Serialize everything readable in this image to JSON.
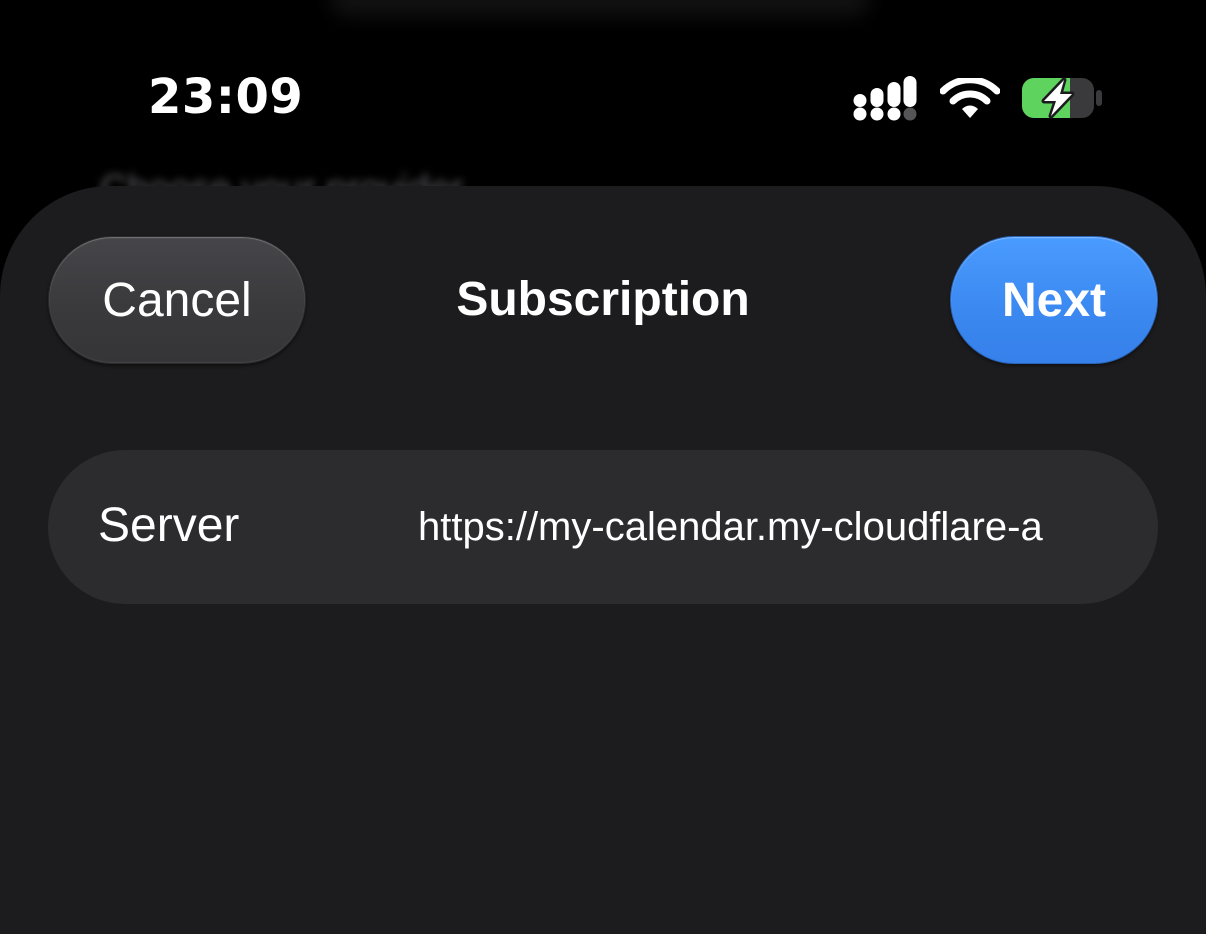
{
  "status_bar": {
    "time": "23:09",
    "icons": [
      "cellular-signal-icon",
      "wifi-icon",
      "battery-charging-icon"
    ]
  },
  "background": {
    "title": "Choose your provider"
  },
  "sheet": {
    "title": "Subscription",
    "cancel_label": "Cancel",
    "next_label": "Next",
    "fields": [
      {
        "label": "Server",
        "value": "https://my-calendar.my-cloudflare-a"
      }
    ]
  },
  "colors": {
    "accent": "#3a88f0",
    "sheet_background": "#1c1c1e",
    "field_background": "#2c2c2e",
    "battery_charge": "#5ed35e"
  }
}
